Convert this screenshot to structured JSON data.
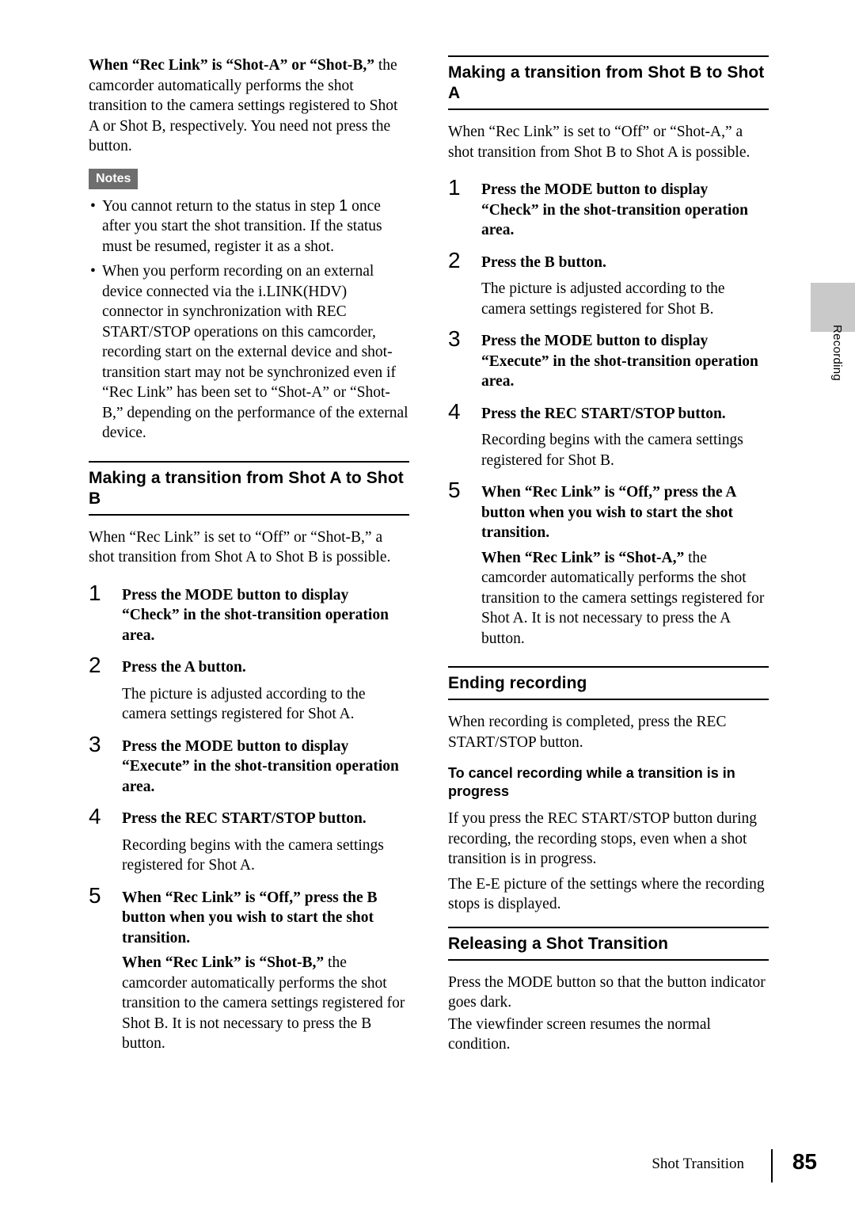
{
  "document": {
    "footer_section": "Shot Transition",
    "page_number": "85",
    "side_tab_label": "Recording"
  },
  "left_column": {
    "intro": {
      "bold_lead": "When “Rec Link” is “Shot-A” or “Shot-B,”",
      "rest": " the camcorder automatically performs the shot transition to the camera settings registered to Shot A or Shot B, respectively. You need not press the button."
    },
    "notes_badge": "Notes",
    "notes": [
      {
        "before": "You cannot return to the status in step ",
        "step_num": "1",
        "after": " once after you start the shot transition. If the status must be resumed, register it as a shot."
      },
      {
        "before": "When you perform recording on an external device connected via the i.LINK(HDV) connector in synchronization with REC START/STOP operations on this camcorder, recording start on the external device and shot-transition start may not be synchronized even if “Rec Link” has been set to “Shot-A” or “Shot-B,” depending on the performance of the external device.",
        "step_num": "",
        "after": ""
      }
    ],
    "section_heading": "Making a transition from Shot A to Shot B",
    "section_intro": "When “Rec Link” is set to “Off” or “Shot-B,” a shot transition from Shot A to Shot B is possible.",
    "steps": [
      {
        "num": "1",
        "title": "Press the MODE button to display “Check” in the shot-transition operation area.",
        "body": ""
      },
      {
        "num": "2",
        "title": "Press the A button.",
        "body": "The picture is adjusted according to the camera settings registered for Shot A."
      },
      {
        "num": "3",
        "title": "Press the MODE button to display “Execute” in the shot-transition operation area.",
        "body": ""
      },
      {
        "num": "4",
        "title": "Press the REC START/STOP button.",
        "body": "Recording begins with the camera settings registered for Shot A."
      },
      {
        "num": "5",
        "title": "When “Rec Link” is “Off,” press the B button when you wish to start the shot transition.",
        "body": ""
      }
    ],
    "final_note": {
      "bold_lead": "When “Rec Link” is “Shot-B,”",
      "rest": " the camcorder automatically performs the shot transition to the camera settings registered for Shot B. It is not necessary to press the B button."
    }
  },
  "right_column": {
    "section_heading": "Making a transition from Shot B to Shot A",
    "section_intro": "When “Rec Link” is set to “Off” or “Shot-A,” a shot transition from Shot B to Shot A is possible.",
    "steps": [
      {
        "num": "1",
        "title": "Press the MODE button to display “Check” in the shot-transition operation area.",
        "body": ""
      },
      {
        "num": "2",
        "title": "Press the B button.",
        "body": "The picture is adjusted according to the camera settings registered for Shot B."
      },
      {
        "num": "3",
        "title": "Press the MODE button to display “Execute” in the shot-transition operation area.",
        "body": ""
      },
      {
        "num": "4",
        "title": "Press the REC START/STOP button.",
        "body": "Recording begins with the camera settings registered for Shot B."
      },
      {
        "num": "5",
        "title": "When “Rec Link” is “Off,” press the A button when you wish to start the shot transition.",
        "body": ""
      }
    ],
    "final_note": {
      "bold_lead": "When “Rec Link” is “Shot-A,”",
      "rest": " the camcorder automatically performs the shot transition to the camera settings registered for Shot A. It is not necessary to press the A button."
    },
    "ending_recording": {
      "heading": "Ending recording",
      "intro": "When recording is completed, press the REC START/STOP button.",
      "sub_heading": "To cancel recording while a transition is in progress",
      "para1": "If you press the REC START/STOP button during recording, the recording stops, even when a shot transition is in progress.",
      "para2": "The E-E picture of the settings where the recording stops is displayed."
    },
    "releasing": {
      "heading": "Releasing a Shot Transition",
      "para1": "Press the MODE button so that the button indicator goes dark.",
      "para2": "The viewfinder screen resumes the normal condition."
    }
  }
}
